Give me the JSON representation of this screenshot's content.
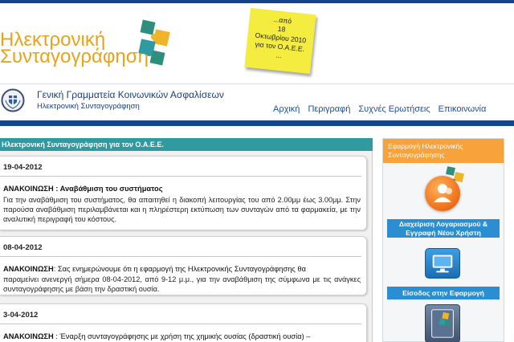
{
  "logo": {
    "line1": "Ηλεκτρονική",
    "line2": "Συνταγογράφηση"
  },
  "sticky_note": [
    "...από",
    "18",
    "Οκτωβρίου 2010",
    "για τον Ο.Α.Ε.Ε.",
    "..."
  ],
  "organization": {
    "title": "Γενική Γραμματεία Κοινωνικών Ασφαλίσεων",
    "subtitle": "Ηλεκτρονική Συνταγογράφηση"
  },
  "nav": [
    {
      "label": "Αρχική"
    },
    {
      "label": "Περιγραφή"
    },
    {
      "label": "Συχνές Ερωτήσεις"
    },
    {
      "label": "Επικοινωνία"
    }
  ],
  "content": {
    "header": "Ηλεκτρονική Συνταγογράφηση για τον Ο.Α.Ε.Ε.",
    "news": [
      {
        "date": "19-04-2012",
        "label": "ΑΝΑΚΟΙΝΩΣΗ",
        "title": " : Αναβάθμιση του συστήματος",
        "body": "Για την αναβάθμιση του συστήματος, θα απαιτηθεί η διακοπή λειτουργίας του από 2.00μμ έως 3.00μμ. Στην παρούσα αναβάθμιση περιλαμβάνεται και η πληρέστερη εκτύπωση των συνταγών από τα φαρμακεία, με την αναλυτική περιγραφή του κόστους."
      },
      {
        "date": "08-04-2012",
        "label": "ΑΝΑΚΟΙΝΩΣΗ",
        "title": ": Σας ενημερώνουμε ότι η εφαρμογή της Ηλεκτρονικής Συνταγογράφησης θα",
        "body": "παραμείνει ανενεργή σήμερα 08-04-2012, από 9-12 μ.μ., για την αναβάθμιση της σύμφωνα με τις ανάγκες συνταγογράφησης με βάση την δραστική ουσία."
      },
      {
        "date": "3-04-2012",
        "label": "ΑΝΑΚΟΙΝΩΣΗ",
        "title": " : Έναρξη συνταγογράφησης με χρήση της χημικής ουσίας (δραστική ουσία) –",
        "body": ""
      }
    ]
  },
  "sidebar": {
    "header": "Εφαρμογή Ηλεκτρονικής Συνταγογράφησης",
    "buttons": [
      {
        "label": "Διαχείριση Λογαριασμού & Εγγραφή Νέου Χρήστη"
      },
      {
        "label": "Είσοδος στην Εφαρμογή"
      }
    ]
  },
  "colors": {
    "brand_blue": "#15438a",
    "teal": "#2f9aa0",
    "orange": "#f7a23a",
    "button_blue": "#2a8ed0",
    "logo_orange": "#e8a31c"
  }
}
